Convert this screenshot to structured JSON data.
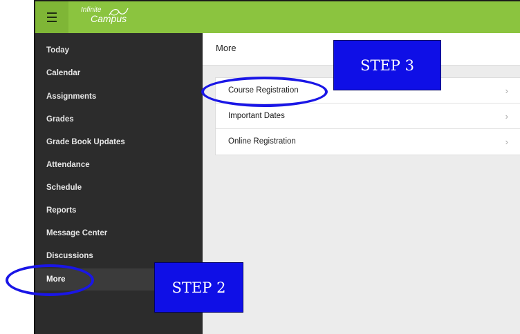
{
  "app": {
    "logo_line1": "Infinite",
    "logo_line2": "Campus"
  },
  "sidebar": {
    "items": [
      {
        "label": "Today"
      },
      {
        "label": "Calendar"
      },
      {
        "label": "Assignments"
      },
      {
        "label": "Grades"
      },
      {
        "label": "Grade Book Updates"
      },
      {
        "label": "Attendance"
      },
      {
        "label": "Schedule"
      },
      {
        "label": "Reports"
      },
      {
        "label": "Message Center"
      },
      {
        "label": "Discussions"
      },
      {
        "label": "More"
      }
    ],
    "active": "More"
  },
  "main": {
    "title": "More",
    "list": [
      {
        "label": "Course Registration",
        "chevron": "›"
      },
      {
        "label": "Important Dates",
        "chevron": "›"
      },
      {
        "label": "Online Registration",
        "chevron": "›"
      }
    ]
  },
  "annotations": {
    "step2": "STEP 2",
    "step3": "STEP 3"
  },
  "colors": {
    "brand_green": "#8bc43f",
    "sidebar_bg": "#2c2c2c",
    "annotation_blue": "#0f0fe6"
  },
  "icons": {
    "menu": "hamburger-menu-icon",
    "logo": "infinite-campus-logo",
    "chevron": "chevron-right-icon"
  }
}
